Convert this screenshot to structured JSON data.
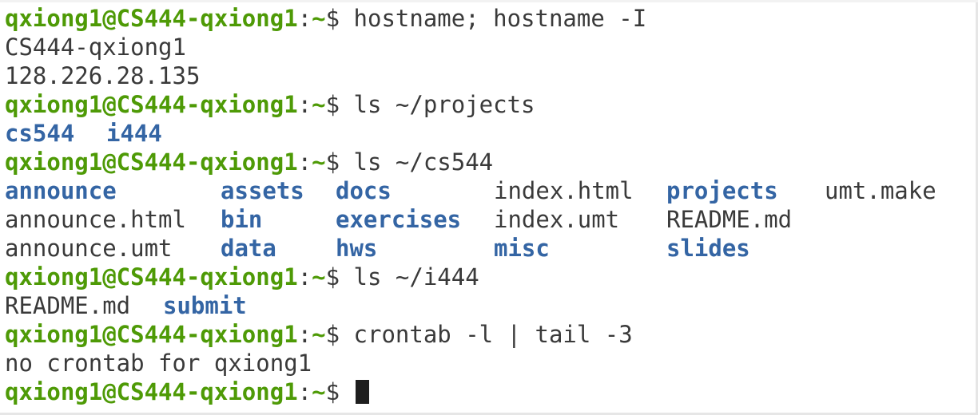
{
  "prompt": {
    "user_host": "qxiong1@CS444-qxiong1",
    "colon": ":",
    "cwd": "~",
    "symbol": "$"
  },
  "lines": {
    "cmd1": "hostname; hostname -I",
    "out1a": "CS444-qxiong1",
    "out1b": "128.226.28.135",
    "cmd2": "ls ~/projects",
    "cmd3": "ls ~/cs544",
    "cmd4": "ls ~/i444",
    "cmd5": "crontab -l | tail -3",
    "out5": "no crontab for qxiong1"
  },
  "projects_listing": [
    {
      "name": "cs544",
      "type": "dir"
    },
    {
      "name": "i444",
      "type": "dir"
    }
  ],
  "cs544_listing": {
    "row1": [
      {
        "name": "announce",
        "type": "dir"
      },
      {
        "name": "assets",
        "type": "dir"
      },
      {
        "name": "docs",
        "type": "dir"
      },
      {
        "name": "index.html",
        "type": "file"
      },
      {
        "name": "projects",
        "type": "dir"
      },
      {
        "name": "umt.make",
        "type": "file"
      }
    ],
    "row2": [
      {
        "name": "announce.html",
        "type": "file"
      },
      {
        "name": "bin",
        "type": "dir"
      },
      {
        "name": "exercises",
        "type": "dir"
      },
      {
        "name": "index.umt",
        "type": "file"
      },
      {
        "name": "README.md",
        "type": "file"
      }
    ],
    "row3": [
      {
        "name": "announce.umt",
        "type": "file"
      },
      {
        "name": "data",
        "type": "dir"
      },
      {
        "name": "hws",
        "type": "dir"
      },
      {
        "name": "misc",
        "type": "dir"
      },
      {
        "name": "slides",
        "type": "dir"
      }
    ]
  },
  "i444_listing": [
    {
      "name": "README.md",
      "type": "file"
    },
    {
      "name": "submit",
      "type": "dir"
    }
  ],
  "colors": {
    "prompt_green": "#4e9a06",
    "dir_blue": "#3465a4",
    "text": "#3a3a3a",
    "background": "#ffffff"
  }
}
